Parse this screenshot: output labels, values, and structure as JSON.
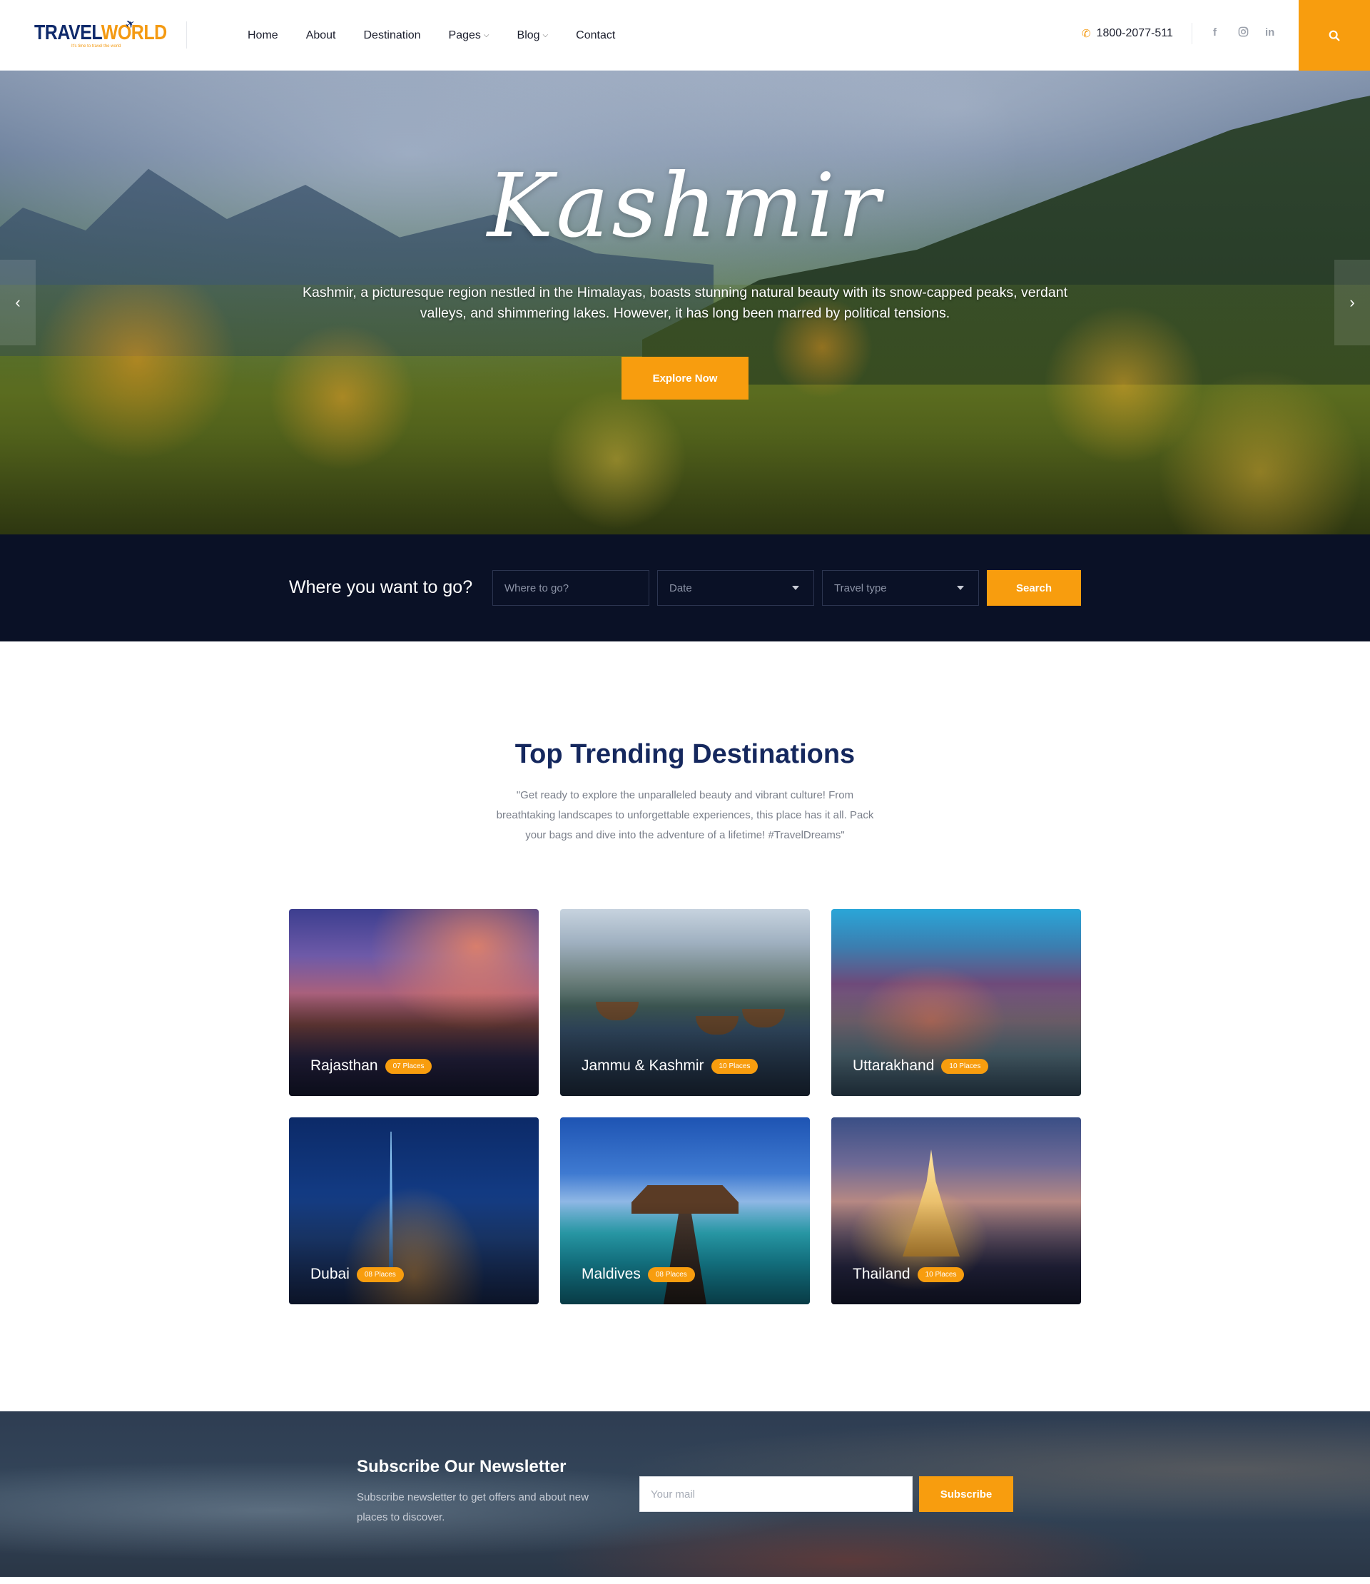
{
  "header": {
    "logo": {
      "word_part1": "TRAVEL",
      "word_part2": "WORLD",
      "tagline": "It's time to travel the world"
    },
    "nav": [
      {
        "label": "Home",
        "dropdown": false
      },
      {
        "label": "About",
        "dropdown": false
      },
      {
        "label": "Destination",
        "dropdown": false
      },
      {
        "label": "Pages",
        "dropdown": true
      },
      {
        "label": "Blog",
        "dropdown": true
      },
      {
        "label": "Contact",
        "dropdown": false
      }
    ],
    "phone": "1800-2077-511",
    "social": [
      "facebook-icon",
      "instagram-icon",
      "linkedin-icon"
    ]
  },
  "hero": {
    "title": "Kashmir",
    "description": "Kashmir, a picturesque region nestled in the Himalayas, boasts stunning natural beauty with its snow-capped peaks, verdant valleys, and shimmering lakes. However, it has long been marred by political tensions.",
    "cta": "Explore Now"
  },
  "search": {
    "title": "Where you want to go?",
    "where_placeholder": "Where to go?",
    "date_label": "Date",
    "type_label": "Travel type",
    "button": "Search"
  },
  "trending": {
    "title": "Top Trending Destinations",
    "description": "\"Get ready to explore the unparalleled beauty and vibrant culture! From breathtaking landscapes to unforgettable experiences, this place has it all. Pack your bags and dive into the adventure of a lifetime! #TravelDreams\"",
    "cards": [
      {
        "name": "Rajasthan",
        "places": "07 Places"
      },
      {
        "name": "Jammu & Kashmir",
        "places": "10 Places"
      },
      {
        "name": "Uttarakhand",
        "places": "10 Places"
      },
      {
        "name": "Dubai",
        "places": "08 Places"
      },
      {
        "name": "Maldives",
        "places": "08 Places"
      },
      {
        "name": "Thailand",
        "places": "10 Places"
      }
    ]
  },
  "newsletter": {
    "title": "Subscribe Our Newsletter",
    "description": "Subscribe newsletter to get offers and about new places to discover.",
    "placeholder": "Your mail",
    "button": "Subscribe"
  },
  "colors": {
    "accent": "#f89d0e",
    "navy": "#0a1126",
    "heading": "#15285e"
  }
}
